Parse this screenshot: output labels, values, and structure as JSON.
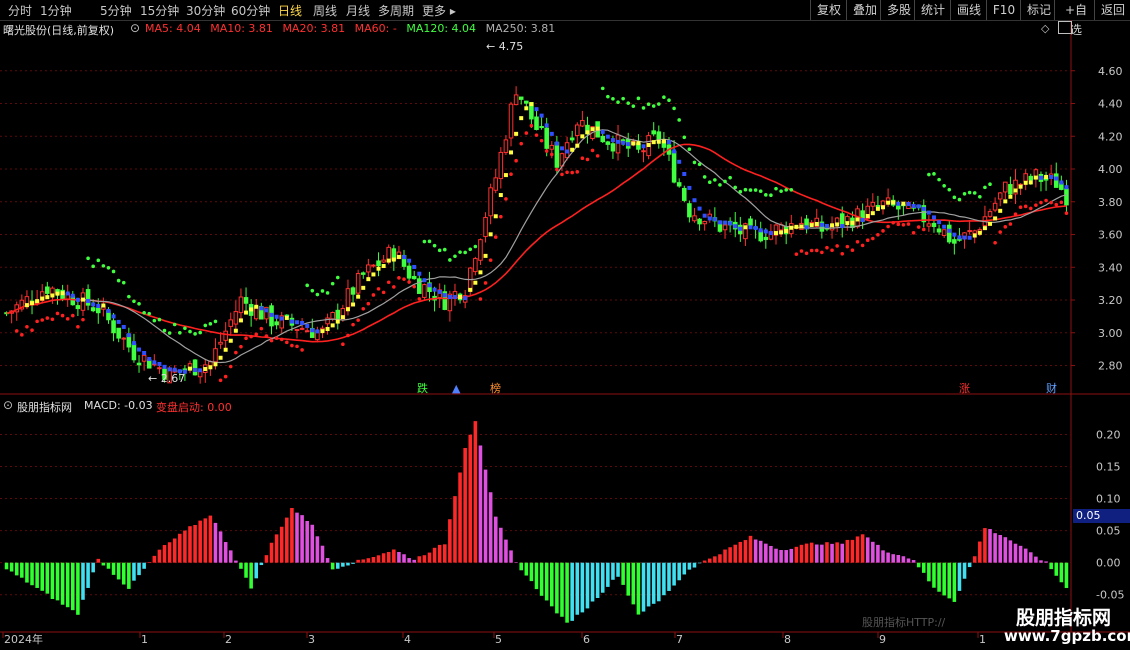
{
  "toolbar": {
    "periods": [
      "分时",
      "1分钟",
      "5分钟",
      "15分钟",
      "30分钟",
      "60分钟",
      "日线",
      "周线",
      "月线",
      "多周期",
      "更多 ▸"
    ],
    "active_period": "日线",
    "right_buttons": [
      "复权",
      "叠加",
      "多股",
      "统计",
      "画线",
      "F10",
      "标记",
      "+自选",
      "返回"
    ]
  },
  "main_panel": {
    "stock_title": "曙光股份(日线,前复权)",
    "ma_labels": [
      {
        "text": "MA5: 4.04",
        "color": "#ff3030"
      },
      {
        "text": "MA10: 3.81",
        "color": "#ff3030"
      },
      {
        "text": "MA20: 3.81",
        "color": "#ff3030"
      },
      {
        "text": "MA60: -",
        "color": "#ff3030"
      },
      {
        "text": "MA120: 4.04",
        "color": "#40ff40"
      },
      {
        "text": "MA250: 3.81",
        "color": "#b0b0b0"
      }
    ],
    "high_label": "4.75",
    "low_label": "2.67",
    "price_ticks": [
      "4.60",
      "4.40",
      "4.20",
      "4.00",
      "3.80",
      "3.60",
      "3.40",
      "3.20",
      "3.00",
      "2.80"
    ],
    "event_markers": [
      {
        "text": "跌",
        "color": "#40ff40"
      },
      {
        "text": "▲",
        "color": "#5080ff"
      },
      {
        "text": "榜",
        "color": "#ff9030"
      },
      {
        "text": "涨",
        "color": "#ff3030"
      },
      {
        "text": "财",
        "color": "#60a0ff"
      }
    ]
  },
  "macd_panel": {
    "name": "股朋指标网",
    "macd_label": "MACD: -0.03",
    "signal_label": "变盘启动: 0.00",
    "ticks": [
      "0.20",
      "0.15",
      "0.10",
      "0.05",
      "0.00",
      "-0.05"
    ],
    "current_value": "0.05"
  },
  "time_axis": [
    "2024年",
    "1",
    "2",
    "3",
    "4",
    "5",
    "6",
    "7",
    "8",
    "9",
    "1"
  ],
  "watermark": {
    "faint_text": "股朋指标HTTP://",
    "site_name": "股朋指标网",
    "site_url": "www.7gpzb.com"
  },
  "colors": {
    "up": "#ff3030",
    "down": "#40ff40",
    "ma_yellow": "#ffff40",
    "ma_red": "#ff2020",
    "ma_gray": "#a0a0a0",
    "sar_green": "#40ff40",
    "sar_red": "#ff2020",
    "blue": "#3050ff",
    "macd_red": "#ff2828",
    "macd_pink": "#e050e0",
    "macd_green": "#30ff30",
    "macd_cyan": "#40e0f0"
  },
  "chart_data": {
    "type": "candlestick",
    "price_range": [
      2.62,
      4.8
    ],
    "macd_range": [
      -0.105,
      0.235
    ],
    "price_path": [
      [
        0,
        3.12
      ],
      [
        8,
        3.28
      ],
      [
        18,
        3.15
      ],
      [
        25,
        2.88
      ],
      [
        32,
        2.75
      ],
      [
        40,
        2.82
      ],
      [
        46,
        3.2
      ],
      [
        52,
        3.08
      ],
      [
        62,
        3.0
      ],
      [
        70,
        3.35
      ],
      [
        76,
        3.5
      ],
      [
        80,
        3.32
      ],
      [
        86,
        3.2
      ],
      [
        90,
        3.28
      ],
      [
        96,
        3.95
      ],
      [
        100,
        4.5
      ],
      [
        104,
        4.25
      ],
      [
        108,
        4.05
      ],
      [
        112,
        4.3
      ],
      [
        118,
        4.18
      ],
      [
        124,
        4.1
      ],
      [
        128,
        4.2
      ],
      [
        134,
        3.75
      ],
      [
        140,
        3.65
      ],
      [
        146,
        3.6
      ],
      [
        150,
        3.62
      ],
      [
        156,
        3.68
      ],
      [
        160,
        3.63
      ],
      [
        166,
        3.7
      ],
      [
        172,
        3.78
      ],
      [
        176,
        3.75
      ],
      [
        182,
        3.68
      ],
      [
        186,
        3.55
      ],
      [
        190,
        3.62
      ],
      [
        196,
        3.88
      ],
      [
        202,
        3.95
      ],
      [
        206,
        3.92
      ],
      [
        208,
        3.84
      ]
    ],
    "macd_path": [
      [
        0,
        -0.01
      ],
      [
        8,
        -0.05
      ],
      [
        14,
        -0.08
      ],
      [
        18,
        0.005
      ],
      [
        24,
        -0.04
      ],
      [
        30,
        0.02
      ],
      [
        36,
        0.055
      ],
      [
        40,
        0.075
      ],
      [
        44,
        0.02
      ],
      [
        48,
        -0.04
      ],
      [
        52,
        0.03
      ],
      [
        56,
        0.085
      ],
      [
        60,
        0.06
      ],
      [
        64,
        -0.01
      ],
      [
        70,
        0.005
      ],
      [
        76,
        0.02
      ],
      [
        80,
        0.005
      ],
      [
        86,
        0.03
      ],
      [
        90,
        0.18
      ],
      [
        92,
        0.222
      ],
      [
        96,
        0.07
      ],
      [
        100,
        0.0
      ],
      [
        106,
        -0.06
      ],
      [
        110,
        -0.095
      ],
      [
        114,
        -0.07
      ],
      [
        120,
        -0.02
      ],
      [
        124,
        -0.08
      ],
      [
        128,
        -0.06
      ],
      [
        134,
        -0.01
      ],
      [
        140,
        0.015
      ],
      [
        146,
        0.04
      ],
      [
        152,
        0.02
      ],
      [
        158,
        0.03
      ],
      [
        164,
        0.03
      ],
      [
        168,
        0.045
      ],
      [
        172,
        0.02
      ],
      [
        178,
        0.005
      ],
      [
        182,
        -0.04
      ],
      [
        186,
        -0.06
      ],
      [
        190,
        0.01
      ],
      [
        192,
        0.055
      ],
      [
        196,
        0.04
      ],
      [
        200,
        0.02
      ],
      [
        204,
        0.0
      ],
      [
        208,
        -0.04
      ]
    ]
  }
}
